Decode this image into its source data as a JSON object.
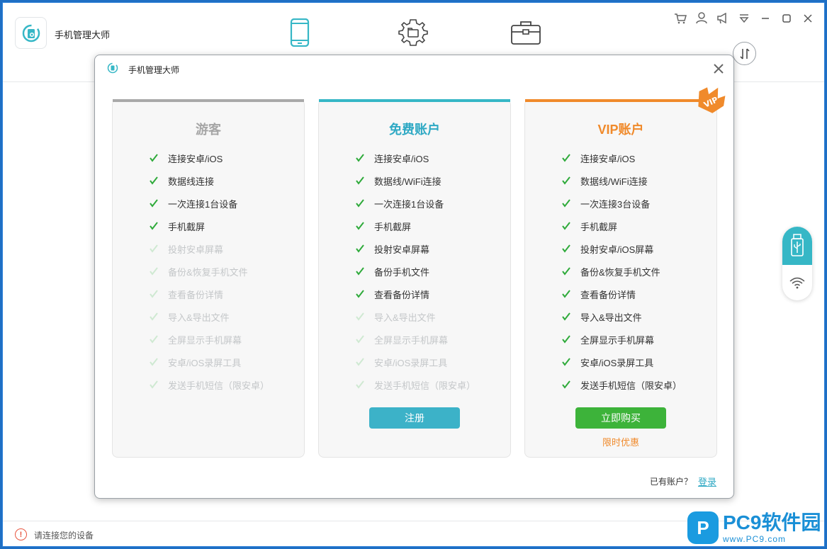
{
  "app": {
    "title": "手机管理大师"
  },
  "nav": [
    {
      "icon": "phone-icon"
    },
    {
      "icon": "gear-folder-icon"
    },
    {
      "icon": "toolbox-icon"
    }
  ],
  "window_controls": [
    "cart-icon",
    "user-icon",
    "megaphone-icon",
    "menu-icon",
    "minimize-icon",
    "maximize-icon",
    "close-icon"
  ],
  "side_widget": {
    "usb_icon": "usb-icon",
    "wifi_icon": "wifi-icon"
  },
  "status": {
    "text": "请连接您的设备"
  },
  "watermark": {
    "badge": "P",
    "main": "PC9软件园",
    "sub": "www.PC9.com"
  },
  "modal": {
    "title": "手机管理大师",
    "footer_text": "已有账户？",
    "login_label": "登录",
    "cards": [
      {
        "title": "游客",
        "features": [
          {
            "text": "连接安卓/iOS",
            "enabled": true
          },
          {
            "text": "数据线连接",
            "enabled": true
          },
          {
            "text": "一次连接1台设备",
            "enabled": true
          },
          {
            "text": "手机截屏",
            "enabled": true
          },
          {
            "text": "投射安卓屏幕",
            "enabled": false
          },
          {
            "text": "备份&恢复手机文件",
            "enabled": false
          },
          {
            "text": "查看备份详情",
            "enabled": false
          },
          {
            "text": "导入&导出文件",
            "enabled": false
          },
          {
            "text": "全屏显示手机屏幕",
            "enabled": false
          },
          {
            "text": "安卓/iOS录屏工具",
            "enabled": false
          },
          {
            "text": "发送手机短信（限安卓）",
            "enabled": false
          }
        ]
      },
      {
        "title": "免费账户",
        "button": "注册",
        "features": [
          {
            "text": "连接安卓/iOS",
            "enabled": true
          },
          {
            "text": "数据线/WiFi连接",
            "enabled": true
          },
          {
            "text": "一次连接1台设备",
            "enabled": true
          },
          {
            "text": "手机截屏",
            "enabled": true
          },
          {
            "text": "投射安卓屏幕",
            "enabled": true
          },
          {
            "text": "备份手机文件",
            "enabled": true
          },
          {
            "text": "查看备份详情",
            "enabled": true
          },
          {
            "text": "导入&导出文件",
            "enabled": false
          },
          {
            "text": "全屏显示手机屏幕",
            "enabled": false
          },
          {
            "text": "安卓/iOS录屏工具",
            "enabled": false
          },
          {
            "text": "发送手机短信（限安卓）",
            "enabled": false
          }
        ]
      },
      {
        "title": "VIP账户",
        "badge": "VIP",
        "button": "立即购买",
        "promo": "限时优惠",
        "features": [
          {
            "text": "连接安卓/iOS",
            "enabled": true
          },
          {
            "text": "数据线/WiFi连接",
            "enabled": true
          },
          {
            "text": "一次连接3台设备",
            "enabled": true
          },
          {
            "text": "手机截屏",
            "enabled": true
          },
          {
            "text": "投射安卓/iOS屏幕",
            "enabled": true
          },
          {
            "text": "备份&恢复手机文件",
            "enabled": true
          },
          {
            "text": "查看备份详情",
            "enabled": true
          },
          {
            "text": "导入&导出文件",
            "enabled": true
          },
          {
            "text": "全屏显示手机屏幕",
            "enabled": true
          },
          {
            "text": "安卓/iOS录屏工具",
            "enabled": true
          },
          {
            "text": "发送手机短信（限安卓）",
            "enabled": true
          }
        ]
      }
    ]
  },
  "colors": {
    "accent": "#36b7c6",
    "guest_bar": "#a9a9a9",
    "guest_title": "#a6a6a6",
    "free_bar": "#36b7c6",
    "free_title": "#2fa9c4",
    "vip_bar": "#f08a2b",
    "vip_title": "#f08a2b",
    "check_on": "#2eaa3a",
    "check_off": "#cfe9d2",
    "register_button": "#3cb2c8",
    "buy_button": "#3db33a",
    "desktop": "#1f6fc4"
  }
}
